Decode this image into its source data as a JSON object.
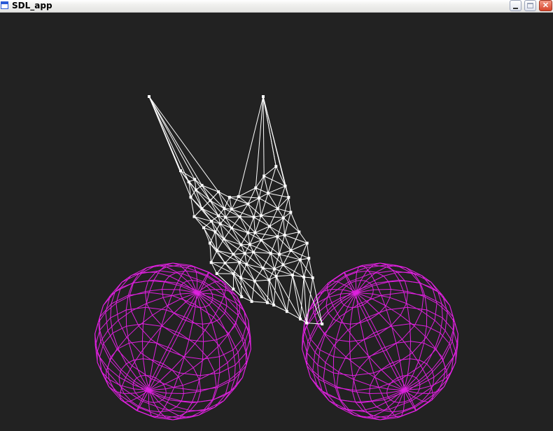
{
  "window": {
    "title": "SDL_app",
    "controls": {
      "minimize": "minimize",
      "maximize": "maximize",
      "close": "close"
    }
  },
  "scene": {
    "background_color": "#222222",
    "cloth_color": "#ffffff",
    "sphere_color": "#e020e0",
    "objects": [
      "cloth-mesh",
      "sphere-left",
      "sphere-right"
    ]
  }
}
